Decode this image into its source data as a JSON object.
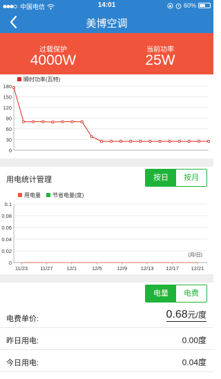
{
  "status_bar": {
    "carrier": "中国电信",
    "time": "14:01",
    "battery": "60%",
    "battery_level": 0.6
  },
  "header": {
    "title": "美博空调",
    "back_icon": "chevron-left-icon"
  },
  "power": {
    "overload_label": "过载保护",
    "overload_value": "4000W",
    "current_label": "当前功率",
    "current_value": "25W"
  },
  "stats": {
    "title": "用电统计管理",
    "period_tabs": [
      {
        "label": "按日",
        "active": true
      },
      {
        "label": "按月",
        "active": false
      }
    ],
    "metric_tabs": [
      {
        "label": "电量",
        "active": true
      },
      {
        "label": "电费",
        "active": false
      }
    ]
  },
  "summary": {
    "unit_price_label": "电费单价:",
    "unit_price_value": "0.68",
    "unit_price_unit": "元/度",
    "yesterday_label": "昨日用电:",
    "yesterday_value": "0.00度",
    "today_label": "今日用电:",
    "today_value": "0.04度"
  },
  "colors": {
    "primary": "#2d83cf",
    "banner": "#f0553c",
    "green": "#1fb33a",
    "series_red": "#d92a1c",
    "series_orange": "#f0553c"
  },
  "chart_data": [
    {
      "type": "line",
      "series": [
        {
          "name": "瞬时功率(瓦特)",
          "values": [
            176,
            80,
            80,
            80,
            79,
            80,
            80,
            80,
            38,
            25,
            25,
            25,
            25,
            25,
            25,
            25,
            25,
            25,
            25,
            25,
            25
          ]
        }
      ],
      "y_ticks": [
        "180",
        "150",
        "120",
        "90",
        "60",
        "30",
        "0"
      ],
      "ylim": [
        0,
        180
      ],
      "grid": true,
      "legend": "top-left"
    },
    {
      "type": "line",
      "categories": [
        "11/23",
        "11/27",
        "12/1",
        "12/5",
        "12/9",
        "12/13",
        "12/17",
        "12/21"
      ],
      "series": [
        {
          "name": "用电量",
          "values": [
            0,
            0,
            0,
            0,
            0,
            0,
            0,
            0
          ]
        },
        {
          "name": "节省电量(度)",
          "values": []
        }
      ],
      "y_ticks": [
        "0.1",
        "0.08",
        "0.06",
        "0.04",
        "0.02",
        "0"
      ],
      "ylim": [
        0,
        0.1
      ],
      "x_unit_label": "(月/日)",
      "grid": true,
      "legend": "top-left"
    }
  ]
}
